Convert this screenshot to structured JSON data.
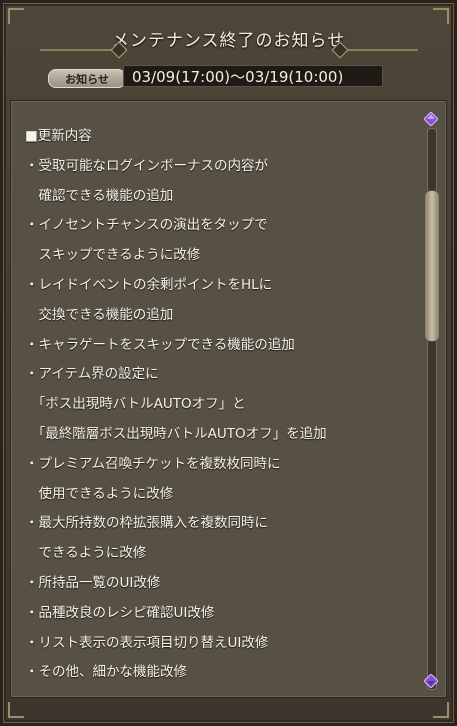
{
  "notice": {
    "title": "メンテナンス終了のお知らせ",
    "badge": "お知らせ",
    "period": "03/09(17:00)～03/19(10:00)"
  },
  "body": {
    "lines": [
      "■更新内容",
      "・受取可能なログインボーナスの内容が",
      "　確認できる機能の追加",
      "・イノセントチャンスの演出をタップで",
      "　スキップできるように改修",
      "・レイドイベントの余剰ポイントをHLに",
      "　交換できる機能の追加",
      "・キャラゲートをスキップできる機能の追加",
      "・アイテム界の設定に",
      "　「ボス出現時バトルAUTOオフ」と",
      "　「最終階層ボス出現時バトルAUTOオフ」を追加",
      "・プレミアム召喚チケットを複数枚同時に",
      "　使用できるように改修",
      "・最大所持数の枠拡張購入を複数同時に",
      "　できるように改修",
      "・所持品一覧のUI改修",
      "・品種改良のレシピ確認UI改修",
      "・リスト表示の表示項目切り替えUI改修",
      "・その他、細かな機能改修"
    ]
  },
  "icons": {
    "scroll_up": "purple-gem-up-icon",
    "scroll_down": "purple-gem-down-icon"
  },
  "colors": {
    "panel": "#575044",
    "frame": "#443c31",
    "text": "#f5f2ea",
    "accent_gem": "#8a4fd6"
  }
}
